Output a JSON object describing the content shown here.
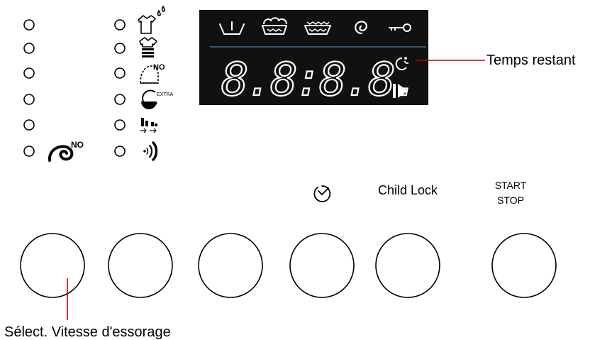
{
  "display": {
    "digits": "8.8:8.8.",
    "icons": [
      "prewash-tub-icon",
      "wash-tub-icon",
      "rinse-tub-icon",
      "spin-icon",
      "key-lock-icon"
    ],
    "status_icons": [
      "remaining-time-icon",
      "start-pause-icon"
    ]
  },
  "indicators": {
    "left_column": [
      {
        "icon": null
      },
      {
        "icon": null
      },
      {
        "icon": null
      },
      {
        "icon": null
      },
      {
        "icon": null
      },
      {
        "icon": "no-spin-icon",
        "badge": "NO"
      }
    ],
    "right_column": [
      {
        "icon": "shirt-drops-icon"
      },
      {
        "icon": "shirt-stack-icon"
      },
      {
        "icon": "no-iron-icon",
        "badge": "NO"
      },
      {
        "icon": "extra-rinse-icon",
        "badge": "EXTRA"
      },
      {
        "icon": "bars-arrows-icon"
      },
      {
        "icon": "sound-wave-icon"
      }
    ]
  },
  "button_labels": {
    "delay_icon": "clock-check-icon",
    "child_lock": "Child Lock",
    "start_line1": "START",
    "start_line2": "STOP"
  },
  "callouts": {
    "remaining_time": "Temps restant",
    "spin_speed": "Sélect. Vitesse d'essorage"
  },
  "colors": {
    "display_bg": "#111111",
    "display_fg": "#ffffff",
    "display_divider": "#4a7fb0",
    "callout_line": "#cc0000",
    "outline": "#000000"
  }
}
